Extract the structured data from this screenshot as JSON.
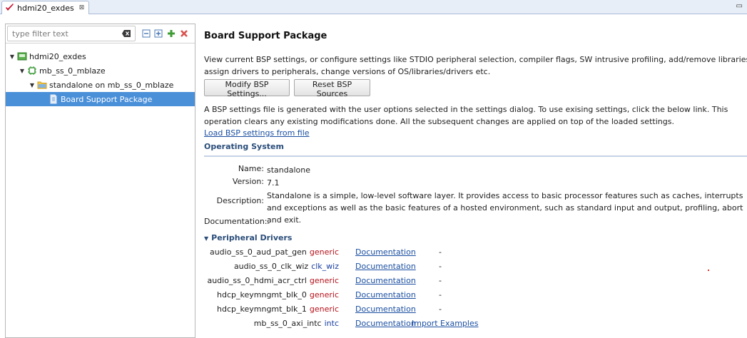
{
  "editor_tab": {
    "title": "hdmi20_exdes",
    "close_glyph": "⊠"
  },
  "minimize_glyph": "▭",
  "filter": {
    "placeholder": "type filter text"
  },
  "tree": [
    {
      "label": "hdmi20_exdes",
      "level": 0,
      "expanded": true,
      "icon": "project-icon"
    },
    {
      "label": "mb_ss_0_mblaze",
      "level": 1,
      "expanded": true,
      "icon": "processor-icon"
    },
    {
      "label": "standalone on mb_ss_0_mblaze",
      "level": 2,
      "expanded": true,
      "icon": "folder-icon"
    },
    {
      "label": "Board Support Package",
      "level": 3,
      "selected": true,
      "icon": "file-icon"
    }
  ],
  "main": {
    "title": "Board Support Package",
    "description": "View current BSP settings, or configure settings like STDIO peripheral selection, compiler flags, SW intrusive profiling, add/remove libraries, assign drivers to peripherals, change versions of OS/libraries/drivers etc.",
    "modify_button": "Modify BSP Settings...",
    "reset_button": "Reset BSP Sources",
    "note": "A BSP settings file is generated with the user options selected in the settings dialog. To use exising settings, click the below link. This operation clears any existing modifications done. All the subsequent changes are applied on top of the loaded settings.",
    "load_link": "Load BSP settings from file",
    "os_section": "Operating System",
    "os": {
      "name_label": "Name:",
      "name": "standalone",
      "version_label": "Version:",
      "version": "7.1",
      "description_label": "Description:",
      "description": "Standalone is a simple, low-level software layer. It provides access to basic processor features such as caches, interrupts and exceptions as well as the basic features of a hosted environment, such as standard input and output, profiling, abort and exit.",
      "documentation_label": "Documentation:",
      "documentation": "-"
    },
    "peripheral_section": "Peripheral Drivers",
    "drivers": [
      {
        "name": "audio_ss_0_aud_pat_gen",
        "driver": "generic",
        "doc": "Documentation",
        "extra": "-",
        "import": ""
      },
      {
        "name": "audio_ss_0_clk_wiz",
        "driver": "clk_wiz",
        "doc": "Documentation",
        "extra": "-",
        "import": ""
      },
      {
        "name": "audio_ss_0_hdmi_acr_ctrl",
        "driver": "generic",
        "doc": "Documentation",
        "extra": "-",
        "import": ""
      },
      {
        "name": "hdcp_keymngmt_blk_0",
        "driver": "generic",
        "doc": "Documentation",
        "extra": "-",
        "import": ""
      },
      {
        "name": "hdcp_keymngmt_blk_1",
        "driver": "generic",
        "doc": "Documentation",
        "extra": "-",
        "import": ""
      },
      {
        "name": "mb_ss_0_axi_intc",
        "driver": "intc",
        "doc": "Documentation",
        "extra": "",
        "import": "Import Examples"
      }
    ]
  },
  "colors": {
    "generic": "#b5121b",
    "specific": "#1a3fa0",
    "link": "#1b4fa1",
    "selection": "#4a90d9"
  }
}
